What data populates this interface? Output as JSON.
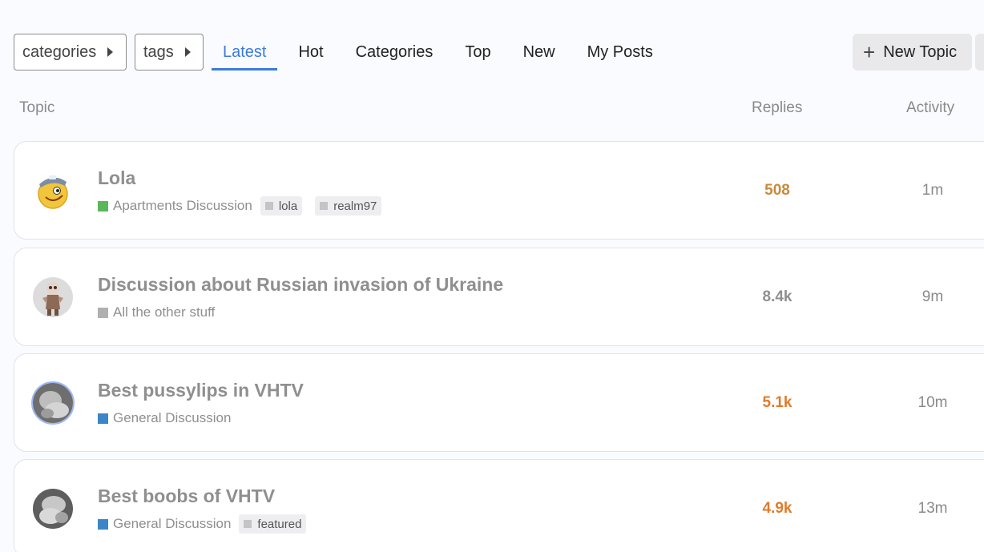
{
  "nav": {
    "categories_label": "categories",
    "tags_label": "tags",
    "tabs": [
      {
        "label": "Latest",
        "active": true
      },
      {
        "label": "Hot"
      },
      {
        "label": "Categories"
      },
      {
        "label": "Top"
      },
      {
        "label": "New"
      },
      {
        "label": "My Posts"
      }
    ],
    "new_topic_label": "New Topic"
  },
  "columns": {
    "topic": "Topic",
    "replies": "Replies",
    "activity": "Activity"
  },
  "colors": {
    "accent": "#3b7bdb",
    "hot_replies": "#e07b2c",
    "warm_replies": "#c98a3b"
  },
  "topics": [
    {
      "title": "Lola",
      "category": "Apartments Discussion",
      "category_color": "#5bb75b",
      "tags": [
        "lola",
        "realm97"
      ],
      "replies": "508",
      "replies_color": "#c98a3b",
      "activity": "1m",
      "avatar": "smiley-cap-avatar"
    },
    {
      "title": "Discussion about Russian invasion of Ukraine",
      "category": "All the other stuff",
      "category_color": "#b0b0b0",
      "tags": [],
      "replies": "8.4k",
      "replies_color": "#8f8f8f",
      "activity": "9m",
      "avatar": "cartoon-figure-avatar"
    },
    {
      "title": "Best pussylips in VHTV",
      "category": "General Discussion",
      "category_color": "#3a86c8",
      "tags": [],
      "replies": "5.1k",
      "replies_color": "#e07b2c",
      "activity": "10m",
      "avatar": "photo-avatar"
    },
    {
      "title": "Best boobs of VHTV",
      "category": "General Discussion",
      "category_color": "#3a86c8",
      "tags": [
        "featured"
      ],
      "replies": "4.9k",
      "replies_color": "#e07b2c",
      "activity": "13m",
      "avatar": "photo-avatar"
    }
  ]
}
